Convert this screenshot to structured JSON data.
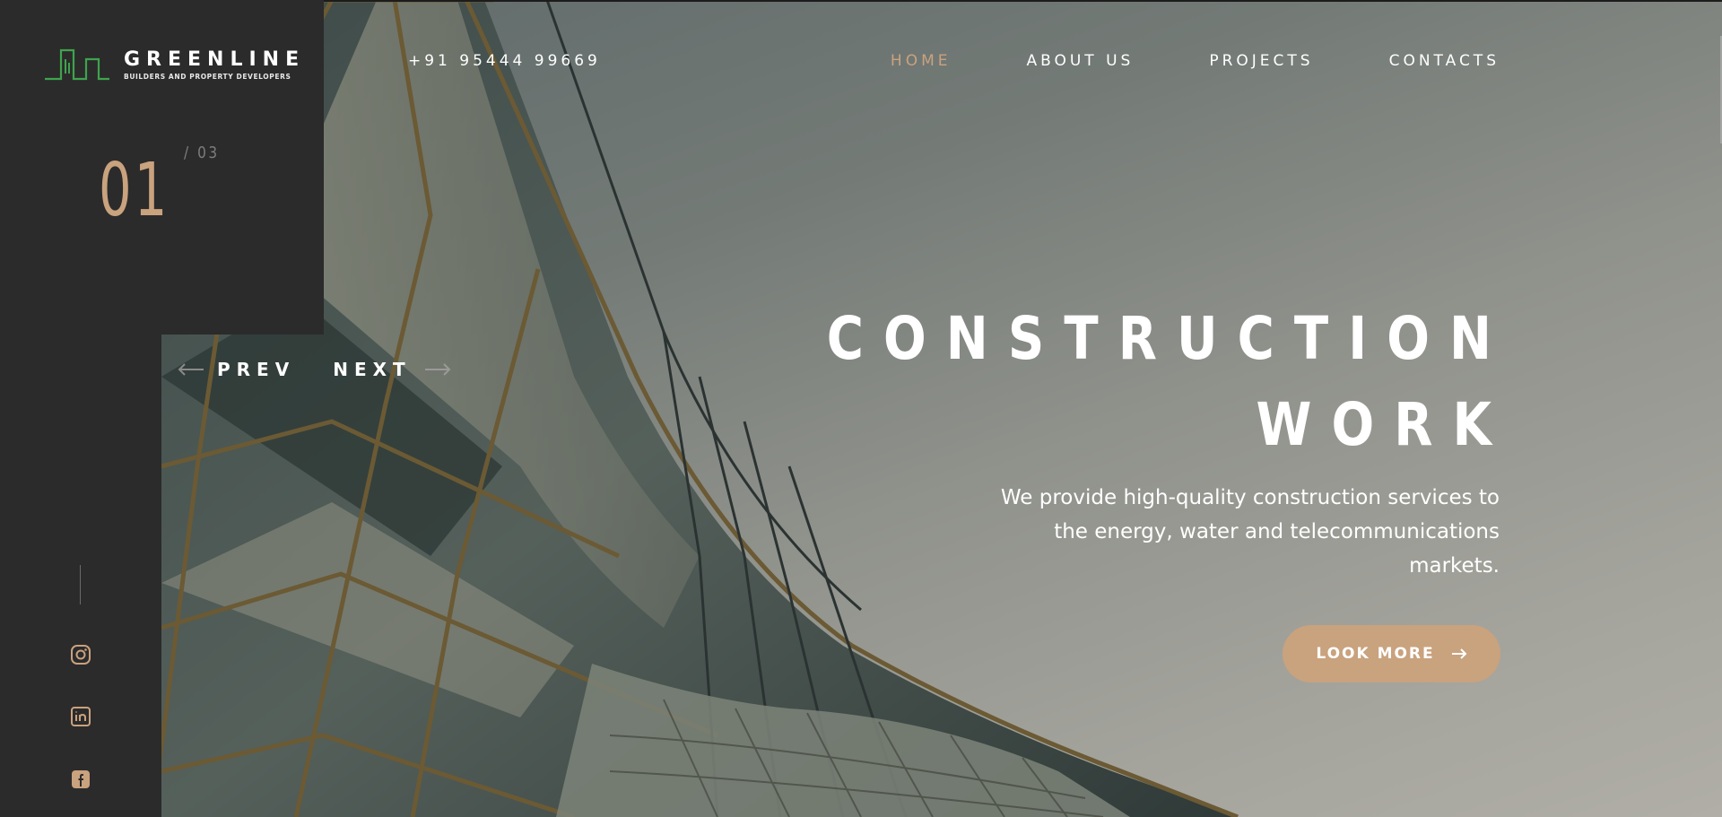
{
  "brand": {
    "name": "GREENLINE",
    "tagline": "BUILDERS AND PROPERTY DEVELOPERS",
    "accent_color": "#c9a27e",
    "logo_color": "#3fa34d"
  },
  "header": {
    "phone": "+91 95444 99669",
    "nav": [
      {
        "label": "HOME",
        "active": true
      },
      {
        "label": "ABOUT US",
        "active": false
      },
      {
        "label": "PROJECTS",
        "active": false
      },
      {
        "label": "CONTACTS",
        "active": false
      }
    ]
  },
  "slider": {
    "current": "01",
    "total": "/ 03",
    "prev_label": "PREV",
    "next_label": "NEXT"
  },
  "hero": {
    "title_line1": "CONSTRUCTION",
    "title_line2": "WORK",
    "description": "We provide high-quality construction services to the energy, water and telecommunications markets.",
    "cta_label": "LOOK MORE"
  },
  "social": [
    {
      "icon": "instagram-icon"
    },
    {
      "icon": "linkedin-icon"
    },
    {
      "icon": "facebook-icon"
    }
  ]
}
